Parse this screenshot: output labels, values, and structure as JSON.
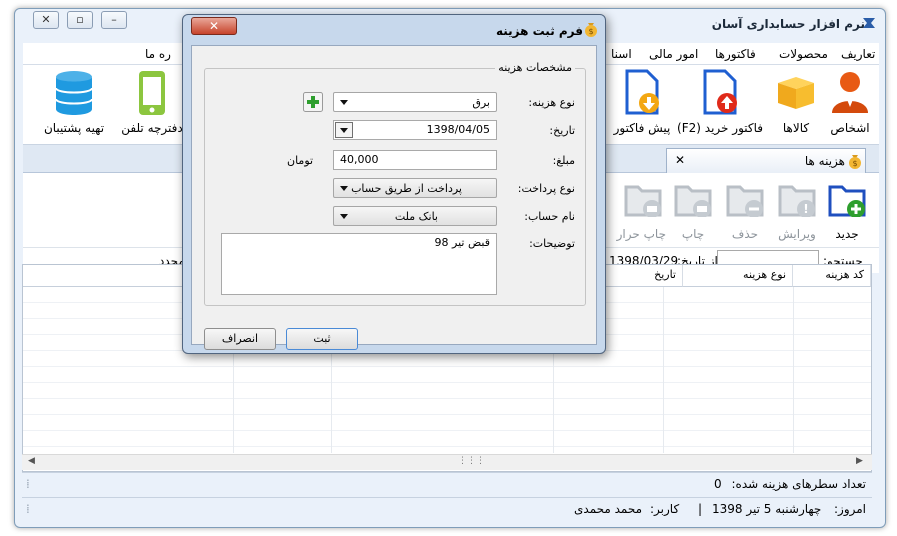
{
  "app": {
    "title": "نرم افزار حسابداری آسان",
    "window_buttons": {
      "close": "✕",
      "restore": "▫",
      "minimize": "–"
    }
  },
  "menu": {
    "items": [
      "تعاریف",
      "محصولات",
      "فاکتورها",
      "امور مالی",
      "اسنا",
      "ره ما"
    ]
  },
  "ribbon": {
    "persons": "اشخاص",
    "goods": "کالاها",
    "purchase_invoice": "فاکتور خرید (F2)",
    "pre_invoice": "پیش فاکتور",
    "phone_book": "دفترچه تلفن",
    "backup": "تهیه پشتیبان"
  },
  "tabs": {
    "expenses": "هزینه ها",
    "close": "✕"
  },
  "toolbar": {
    "new": "جدید",
    "edit": "ویرایش",
    "delete": "حذف",
    "print": "چاپ",
    "print_heat": "چاپ حرار"
  },
  "search": {
    "label": "جستجو:",
    "from_date_label": "از تاریخ:",
    "from_date": "1398/03/29",
    "repeat_label": "مجدد"
  },
  "grid": {
    "columns": [
      "کد هزینه",
      "نوع هزینه",
      "تاریخ"
    ],
    "rows": []
  },
  "status": {
    "count_label": "تعداد سطرهای هزینه شده:",
    "count_value": "0",
    "today_label": "امروز:",
    "today": "چهارشنبه 5 تیر 1398",
    "separator": "|",
    "user_label": "کاربر:",
    "user": "محمد محمدی"
  },
  "dialog": {
    "title": "فرم ثبت هزینه",
    "close": "✕",
    "group_title": "مشخصات هزینه",
    "fields": {
      "expense_type_label": "نوع هزینه:",
      "expense_type": "برق",
      "date_label": "تاریخ:",
      "date": "1398/04/05",
      "amount_label": "مبلغ:",
      "amount": "40,000",
      "currency": "تومان",
      "payment_type_label": "نوع پرداخت:",
      "payment_type": "پرداخت از طریق حساب",
      "account_name_label": "نام حساب:",
      "account_name": "بانک ملت",
      "description_label": "توضیحات:",
      "description": "قبض تیر 98"
    },
    "buttons": {
      "submit": "ثبت",
      "cancel": "انصراف"
    }
  },
  "colors": {
    "accent": "#2f6fd1",
    "add_green": "#2e9e2e",
    "close_red": "#c7432b",
    "folder_gray": "#b9bfc6"
  }
}
